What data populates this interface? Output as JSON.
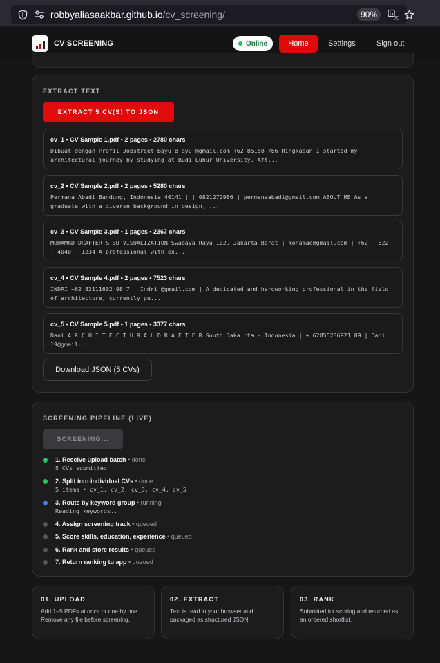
{
  "browser": {
    "url_host": "robbyaliasaakbar.github.io",
    "url_path": "/cv_screening/",
    "zoom": "90%"
  },
  "header": {
    "brand": "CV SCREENING",
    "status": "Online",
    "nav": {
      "home": "Home",
      "settings": "Settings",
      "signout": "Sign out"
    }
  },
  "extract": {
    "title": "EXTRACT TEXT",
    "button": "EXTRACT 5 CV(S) TO JSON",
    "items": [
      {
        "head": "cv_1 • CV Sample 1.pdf • 2 pages • 2780 chars",
        "text": "Dibuat dengan Profil Jobstreet Bayu B ayu @gmail.com +62 85158 786 Ringkasan I started my architectural journey by studying at Budi Luhur University. Aft..."
      },
      {
        "head": "cv_2 • CV Sample 2.pdf • 2 pages • 5280 chars",
        "text": "Permana Abadi Bandung, Indonesia 40141 | | 0821272986 | permanaabadi@gmail.com ABOUT ME As a graduate with a diverse background in design, ..."
      },
      {
        "head": "cv_3 • CV Sample 3.pdf • 1 pages • 2367 chars",
        "text": "MOHAMAD DRAFTER & 3D VISUALIZATION Swadaya Raya 102, Jakarta Barat | mohamad@gmail.com | +62 - 822 - 4040 - 1234 A professional with ex..."
      },
      {
        "head": "cv_4 • CV Sample 4.pdf • 2 pages • 7523 chars",
        "text": "INDRI +62 82111602 98 7 | Indri @gmail.com | A dedicated and hardworking professional in the field of architecture, currently pu..."
      },
      {
        "head": "cv_5 • CV Sample 5.pdf • 1 pages • 3377 chars",
        "text": "Dani A R C H I T E C T U R A L D R A F T E R South Jaka rta - Indonesia | + 62855236921 89 | Dani 19@gmail..."
      }
    ],
    "download": "Download JSON (5 CVs)"
  },
  "pipeline": {
    "title": "SCREENING PIPELINE (LIVE)",
    "button": "SCREENING...",
    "steps": [
      {
        "name": "1. Receive upload batch",
        "status": "• done",
        "detail": "5 CVs submitted",
        "color": "#22c55e"
      },
      {
        "name": "2. Split into individual CVs",
        "status": "• done",
        "detail": "5 items • cv_1, cv_2, cv_3, cv_4, cv_5",
        "color": "#22c55e"
      },
      {
        "name": "3. Route by keyword group",
        "status": "• running",
        "detail": "Reading keywords...",
        "color": "#3b82f6"
      },
      {
        "name": "4. Assign screening track",
        "status": "• queued",
        "detail": "",
        "color": "#555558"
      },
      {
        "name": "5. Score skills, education, experience",
        "status": "• queued",
        "detail": "",
        "color": "#555558"
      },
      {
        "name": "6. Rank and store results",
        "status": "• queued",
        "detail": "",
        "color": "#555558"
      },
      {
        "name": "7. Return ranking to app",
        "status": "• queued",
        "detail": "",
        "color": "#555558"
      }
    ]
  },
  "info": [
    {
      "title": "01. UPLOAD",
      "body": "Add 1–5 PDFs at once or one by one. Remove any file before screening."
    },
    {
      "title": "02. EXTRACT",
      "body": "Text is read in your browser and packaged as structured JSON."
    },
    {
      "title": "03. RANK",
      "body": "Submitted for scoring and returned as an ordered shortlist."
    }
  ]
}
